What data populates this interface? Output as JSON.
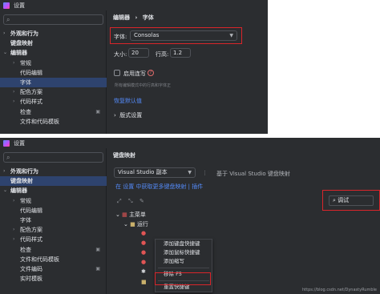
{
  "panel1": {
    "window_title": "设置",
    "search_placeholder": "",
    "tree": [
      {
        "label": "外观和行为",
        "caret": "›",
        "indent": 0,
        "bold": true
      },
      {
        "label": "键盘映射",
        "caret": "",
        "indent": 0,
        "bold": true
      },
      {
        "label": "编辑器",
        "caret": "⌄",
        "indent": 0,
        "bold": true
      },
      {
        "label": "常规",
        "caret": "›",
        "indent": 1
      },
      {
        "label": "代码编辑",
        "caret": "",
        "indent": 1
      },
      {
        "label": "字体",
        "caret": "",
        "indent": 1,
        "selected": true
      },
      {
        "label": "配色方案",
        "caret": "›",
        "indent": 1
      },
      {
        "label": "代码样式",
        "caret": "›",
        "indent": 1
      },
      {
        "label": "检查",
        "caret": "",
        "indent": 1,
        "badge": "▣"
      },
      {
        "label": "文件和代码模板",
        "caret": "",
        "indent": 1
      }
    ],
    "breadcrumb": {
      "parent": "编辑器",
      "sep": "›",
      "current": "字体"
    },
    "font_label": "字体:",
    "font_value": "Consolas",
    "size_label": "大小:",
    "size_value": "20",
    "line_height_label": "行高:",
    "line_height_value": "1.2",
    "ligatures_label": "启用连写",
    "ligatures_hint": "所有编辑模式中的行高和字体正",
    "restore_defaults": "恢复默认值",
    "fallback_section": "版式设置"
  },
  "panel2": {
    "window_title": "设置",
    "search_placeholder": "",
    "tree": [
      {
        "label": "外观和行为",
        "caret": "›",
        "indent": 0,
        "bold": true
      },
      {
        "label": "键盘映射",
        "caret": "",
        "indent": 0,
        "bold": true,
        "selected": true
      },
      {
        "label": "编辑器",
        "caret": "⌄",
        "indent": 0,
        "bold": true
      },
      {
        "label": "常规",
        "caret": "›",
        "indent": 1
      },
      {
        "label": "代码编辑",
        "caret": "",
        "indent": 1
      },
      {
        "label": "字体",
        "caret": "",
        "indent": 1
      },
      {
        "label": "配色方案",
        "caret": "›",
        "indent": 1
      },
      {
        "label": "代码样式",
        "caret": "›",
        "indent": 1
      },
      {
        "label": "检查",
        "caret": "",
        "indent": 1,
        "badge": "▣"
      },
      {
        "label": "文件和代码模板",
        "caret": "",
        "indent": 1
      },
      {
        "label": "文件编码",
        "caret": "",
        "indent": 1,
        "badge": "▣"
      },
      {
        "label": "实时模板",
        "caret": "",
        "indent": 1
      }
    ],
    "page_title": "键盘映射",
    "keymap_value": "Visual Studio 副本",
    "keymap_more": "⋮",
    "based_on": "基于 Visual Studio 键盘映射",
    "link_text": "在 设置 中获取更多键盘映射 | 插件",
    "search_value": "调试",
    "tree_root": "主菜单",
    "tree_child": "运行",
    "context_menu": [
      {
        "label": "添加键盘快捷键"
      },
      {
        "label": "添加鼠标快捷键"
      },
      {
        "label": "添加缩写"
      },
      {
        "sep": true
      },
      {
        "label": "移除 F5"
      },
      {
        "sep": true
      },
      {
        "label": "重置快捷键"
      }
    ],
    "watermark": "https://blog.csdn.net/DynastyRumble"
  },
  "colors": {
    "bg": "#2b2d30",
    "selection": "#2e436e",
    "accent_link": "#548af7",
    "highlight_border": "#d9252a"
  }
}
